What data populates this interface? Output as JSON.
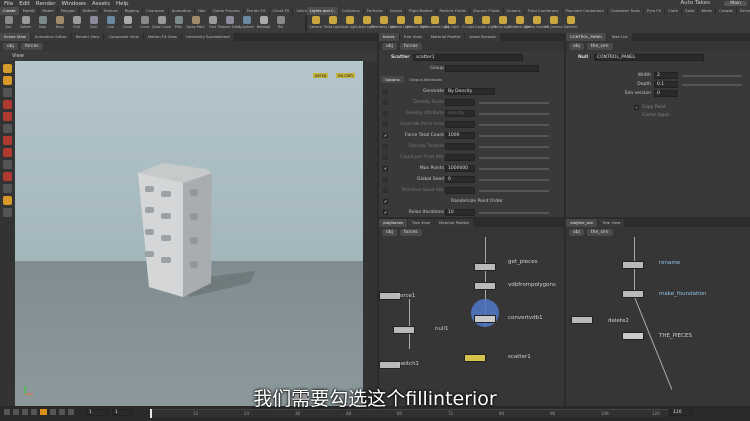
{
  "menubar": {
    "items": [
      "File",
      "Edit",
      "Render",
      "Windows",
      "Assets",
      "Help"
    ],
    "auto_takes": "Auto Takes",
    "desktop": "Main"
  },
  "shelf_left": {
    "tabs": [
      "Create",
      "Modify",
      "Model",
      "Polygon",
      "Deform",
      "Texture",
      "Rigging",
      "Character",
      "Animation",
      "Hair",
      "Guide Process",
      "Terrain FX",
      "Cloud FX",
      "Volume"
    ],
    "tools": [
      "Box",
      "Sphere",
      "Tube",
      "Torus",
      "Grid",
      "Null",
      "Line",
      "Circle",
      "Curve",
      "Draw Curve",
      "Path",
      "Spray Paint",
      "Font",
      "Platonic Solids",
      "L-System",
      "Metaball",
      "File"
    ]
  },
  "shelf_right": {
    "tabs": [
      "Lights and C.",
      "Collisions",
      "Particles",
      "Grains",
      "Rigid Bodies",
      "Particle Fluids",
      "Viscous Fluids",
      "Oceans",
      "Fluid Containers",
      "Populate Containers",
      "Container Tools",
      "Pyro FX",
      "Cloth",
      "Solid",
      "Wires",
      "Crowds",
      "Drive Simula."
    ],
    "tools": [
      "Camera",
      "Point Light",
      "Spot Light",
      "Area Light",
      "Geometry Light",
      "Volume Light",
      "Distant Light",
      "Environment Light",
      "Sky Light",
      "GI Light",
      "Caustic Light",
      "Portal Light",
      "Ambient Light",
      "Stereo Camera",
      "VR Camera",
      "Switcher"
    ]
  },
  "viewport": {
    "tabs": [
      "Scene View",
      "Animation Editor",
      "Render View",
      "Composite View",
      "Motion FX View",
      "Geometry Spreadsheet"
    ],
    "path": [
      "obj",
      "forces"
    ],
    "header": "View",
    "persp": "persp",
    "cam": "no cam"
  },
  "params": {
    "tabs": [
      "forces",
      "Tree View",
      "Material Palette",
      "Asset Browser"
    ],
    "path": [
      "obj",
      "forces"
    ],
    "node_type": "Scatter",
    "node_name": "scatter1",
    "group_label": "Group",
    "sub_tabs": [
      "Options",
      "Output Attributes"
    ],
    "rows": [
      {
        "label": "Generate",
        "value": "By Density",
        "dim": false,
        "check": ""
      },
      {
        "label": "Density Scale",
        "value": "",
        "dim": true,
        "check": ""
      },
      {
        "label": "Density Attribute",
        "value": "density",
        "dim": true,
        "check": ""
      },
      {
        "label": "Override Point Area",
        "value": "",
        "dim": true,
        "check": ""
      },
      {
        "label": "Force Total Count",
        "value": "1000",
        "dim": false,
        "check": "✔"
      },
      {
        "label": "Density Texture",
        "value": "",
        "dim": true,
        "check": ""
      },
      {
        "label": "Count per Prim Attr",
        "value": "",
        "dim": true,
        "check": ""
      },
      {
        "label": "Max Points",
        "value": "1000000",
        "dim": false,
        "check": "✔"
      },
      {
        "label": "Global Seed",
        "value": "0",
        "dim": false,
        "check": ""
      },
      {
        "label": "Primitive Seed Attr",
        "value": "",
        "dim": true,
        "check": ""
      },
      {
        "label": "Randomize Point Order",
        "value": "",
        "dim": false,
        "check": "✔"
      },
      {
        "label": "Relax Iterations",
        "value": "10",
        "dim": false,
        "check": "✔"
      }
    ]
  },
  "control": {
    "tabs": [
      "CONTROL_PANEL",
      "Take List"
    ],
    "path": [
      "obj",
      "the_sim"
    ],
    "node_type": "Null",
    "node_name": "CONTROL_PANEL",
    "rows": [
      {
        "label": "Width",
        "value": "2"
      },
      {
        "label": "Depth",
        "value": "0.1"
      },
      {
        "label": "Sim version",
        "value": "0"
      }
    ],
    "buttons": [
      "Copy Point",
      "Cache Input"
    ]
  },
  "net_left": {
    "tabs": [
      "/obj/forces",
      "Tree View",
      "Material Palette"
    ],
    "path": [
      "obj",
      "forces"
    ],
    "nodes": [
      {
        "name": "get_pieces",
        "blue": false
      },
      {
        "name": "vdbfrompolygons",
        "blue": false
      },
      {
        "name": "force1",
        "blue": false
      },
      {
        "name": "convertvdb1",
        "blue": false
      },
      {
        "name": "null1",
        "blue": false
      },
      {
        "name": "scatter1",
        "blue": false
      },
      {
        "name": "switch1",
        "blue": false
      }
    ]
  },
  "net_right": {
    "tabs": [
      "/obj/the_sim",
      "Tree View"
    ],
    "path": [
      "obj",
      "the_sim"
    ],
    "nodes": [
      {
        "name": "rename",
        "blue": true
      },
      {
        "name": "make_foundation",
        "blue": true
      },
      {
        "name": "delete2",
        "blue": false
      },
      {
        "name": "THE_PIECES",
        "blue": false
      }
    ]
  },
  "timeline": {
    "frame": "1",
    "start": "1",
    "end": "120",
    "ticks": [
      "12",
      "24",
      "36",
      "48",
      "60",
      "72",
      "84",
      "96",
      "108",
      "120"
    ]
  },
  "subtitle": "我们需要勾选这个fillinterior"
}
